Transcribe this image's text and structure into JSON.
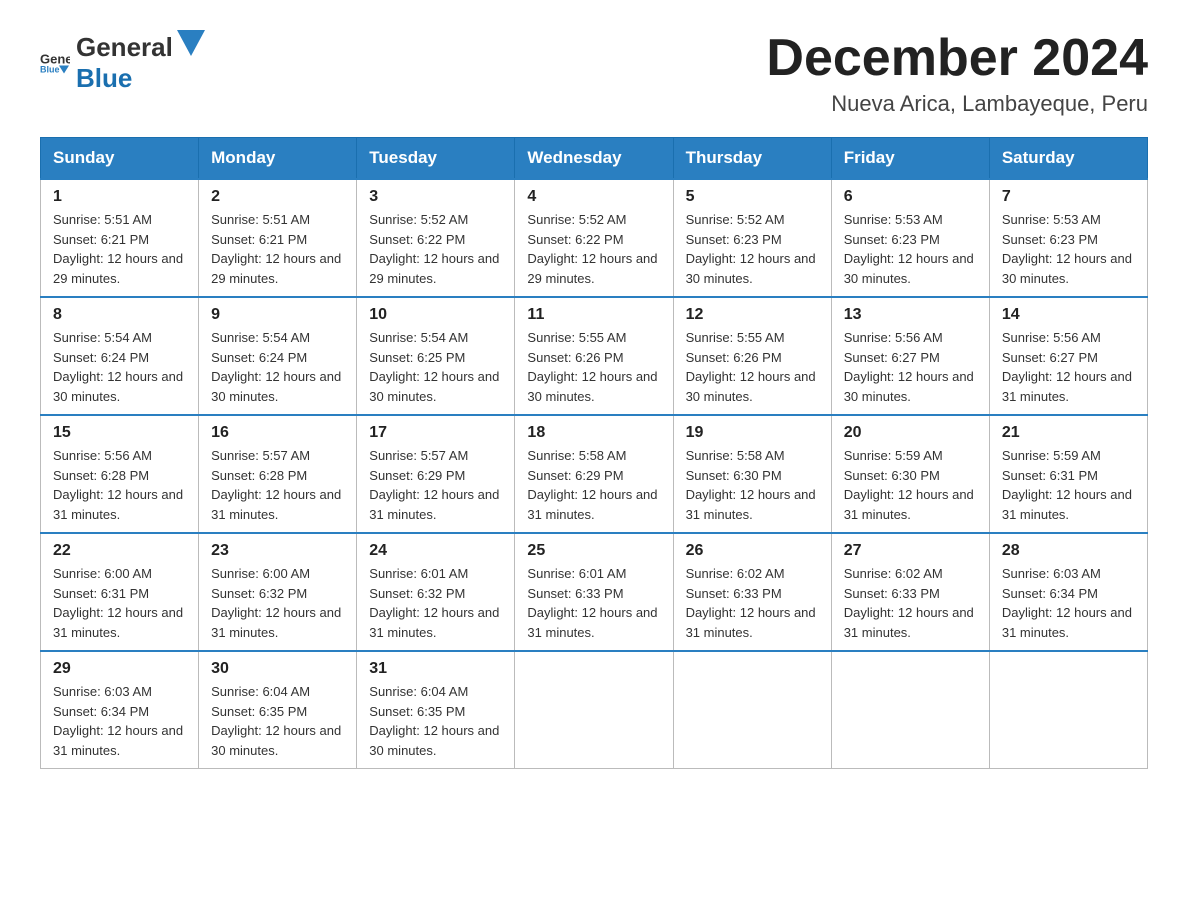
{
  "header": {
    "logo_general": "General",
    "logo_blue": "Blue",
    "month_title": "December 2024",
    "location": "Nueva Arica, Lambayeque, Peru"
  },
  "days_of_week": [
    "Sunday",
    "Monday",
    "Tuesday",
    "Wednesday",
    "Thursday",
    "Friday",
    "Saturday"
  ],
  "weeks": [
    [
      {
        "day": "1",
        "sunrise": "5:51 AM",
        "sunset": "6:21 PM",
        "daylight": "12 hours and 29 minutes."
      },
      {
        "day": "2",
        "sunrise": "5:51 AM",
        "sunset": "6:21 PM",
        "daylight": "12 hours and 29 minutes."
      },
      {
        "day": "3",
        "sunrise": "5:52 AM",
        "sunset": "6:22 PM",
        "daylight": "12 hours and 29 minutes."
      },
      {
        "day": "4",
        "sunrise": "5:52 AM",
        "sunset": "6:22 PM",
        "daylight": "12 hours and 29 minutes."
      },
      {
        "day": "5",
        "sunrise": "5:52 AM",
        "sunset": "6:23 PM",
        "daylight": "12 hours and 30 minutes."
      },
      {
        "day": "6",
        "sunrise": "5:53 AM",
        "sunset": "6:23 PM",
        "daylight": "12 hours and 30 minutes."
      },
      {
        "day": "7",
        "sunrise": "5:53 AM",
        "sunset": "6:23 PM",
        "daylight": "12 hours and 30 minutes."
      }
    ],
    [
      {
        "day": "8",
        "sunrise": "5:54 AM",
        "sunset": "6:24 PM",
        "daylight": "12 hours and 30 minutes."
      },
      {
        "day": "9",
        "sunrise": "5:54 AM",
        "sunset": "6:24 PM",
        "daylight": "12 hours and 30 minutes."
      },
      {
        "day": "10",
        "sunrise": "5:54 AM",
        "sunset": "6:25 PM",
        "daylight": "12 hours and 30 minutes."
      },
      {
        "day": "11",
        "sunrise": "5:55 AM",
        "sunset": "6:26 PM",
        "daylight": "12 hours and 30 minutes."
      },
      {
        "day": "12",
        "sunrise": "5:55 AM",
        "sunset": "6:26 PM",
        "daylight": "12 hours and 30 minutes."
      },
      {
        "day": "13",
        "sunrise": "5:56 AM",
        "sunset": "6:27 PM",
        "daylight": "12 hours and 30 minutes."
      },
      {
        "day": "14",
        "sunrise": "5:56 AM",
        "sunset": "6:27 PM",
        "daylight": "12 hours and 31 minutes."
      }
    ],
    [
      {
        "day": "15",
        "sunrise": "5:56 AM",
        "sunset": "6:28 PM",
        "daylight": "12 hours and 31 minutes."
      },
      {
        "day": "16",
        "sunrise": "5:57 AM",
        "sunset": "6:28 PM",
        "daylight": "12 hours and 31 minutes."
      },
      {
        "day": "17",
        "sunrise": "5:57 AM",
        "sunset": "6:29 PM",
        "daylight": "12 hours and 31 minutes."
      },
      {
        "day": "18",
        "sunrise": "5:58 AM",
        "sunset": "6:29 PM",
        "daylight": "12 hours and 31 minutes."
      },
      {
        "day": "19",
        "sunrise": "5:58 AM",
        "sunset": "6:30 PM",
        "daylight": "12 hours and 31 minutes."
      },
      {
        "day": "20",
        "sunrise": "5:59 AM",
        "sunset": "6:30 PM",
        "daylight": "12 hours and 31 minutes."
      },
      {
        "day": "21",
        "sunrise": "5:59 AM",
        "sunset": "6:31 PM",
        "daylight": "12 hours and 31 minutes."
      }
    ],
    [
      {
        "day": "22",
        "sunrise": "6:00 AM",
        "sunset": "6:31 PM",
        "daylight": "12 hours and 31 minutes."
      },
      {
        "day": "23",
        "sunrise": "6:00 AM",
        "sunset": "6:32 PM",
        "daylight": "12 hours and 31 minutes."
      },
      {
        "day": "24",
        "sunrise": "6:01 AM",
        "sunset": "6:32 PM",
        "daylight": "12 hours and 31 minutes."
      },
      {
        "day": "25",
        "sunrise": "6:01 AM",
        "sunset": "6:33 PM",
        "daylight": "12 hours and 31 minutes."
      },
      {
        "day": "26",
        "sunrise": "6:02 AM",
        "sunset": "6:33 PM",
        "daylight": "12 hours and 31 minutes."
      },
      {
        "day": "27",
        "sunrise": "6:02 AM",
        "sunset": "6:33 PM",
        "daylight": "12 hours and 31 minutes."
      },
      {
        "day": "28",
        "sunrise": "6:03 AM",
        "sunset": "6:34 PM",
        "daylight": "12 hours and 31 minutes."
      }
    ],
    [
      {
        "day": "29",
        "sunrise": "6:03 AM",
        "sunset": "6:34 PM",
        "daylight": "12 hours and 31 minutes."
      },
      {
        "day": "30",
        "sunrise": "6:04 AM",
        "sunset": "6:35 PM",
        "daylight": "12 hours and 30 minutes."
      },
      {
        "day": "31",
        "sunrise": "6:04 AM",
        "sunset": "6:35 PM",
        "daylight": "12 hours and 30 minutes."
      },
      null,
      null,
      null,
      null
    ]
  ]
}
